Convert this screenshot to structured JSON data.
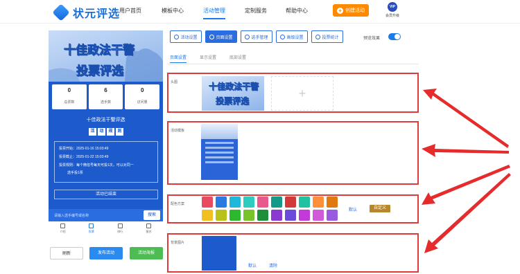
{
  "brand": {
    "name": "状元评选"
  },
  "nav": {
    "home": "用户首页",
    "templates": "模板中心",
    "activity": "活动管理",
    "custom": "定制服务",
    "help": "帮助中心"
  },
  "header": {
    "create_label": "创建活动",
    "vip_badge": "VIP",
    "vip_label": "会员升级"
  },
  "phone": {
    "banner_line1": "十佳政法干警",
    "banner_line2": "投票评选",
    "stats": [
      {
        "value": "0",
        "label": "总票数"
      },
      {
        "value": "6",
        "label": "选手数"
      },
      {
        "value": "0",
        "label": "访问量"
      }
    ],
    "title": "十佳政法干警评选",
    "rules_chars": [
      "活",
      "动",
      "规",
      "则"
    ],
    "rules": [
      "投票开始：2025-01-16 15:03:49",
      "投票截止：2025-01-22 15:03:49",
      "投票规则：每个微信号每天可投1次，可以对同一",
      "选手投1票"
    ],
    "status": "活动已结束",
    "search_placeholder": "请输入选手编号或名称",
    "search_button": "搜索",
    "tabs": [
      "介绍",
      "投票",
      "排行",
      "报名"
    ]
  },
  "bottom_buttons": {
    "refresh": "刷新",
    "publish": "发布活动",
    "poster": "活动海报"
  },
  "toolbar": {
    "items": [
      "活动设置",
      "页面设置",
      "选手管理",
      "高级设置",
      "投票统计"
    ],
    "preview_label": "预览效果"
  },
  "subtabs": [
    "页面设置",
    "显示设置",
    "底部设置"
  ],
  "panels": {
    "head_label": "头图",
    "head_img_line1": "十佳政法干警",
    "head_img_line2": "投票评选",
    "add_symbol": "+",
    "template_label": "活动模板",
    "color_label": "配色方案",
    "default_link": "默认",
    "custom_button": "自定义",
    "bg_label": "背景图片",
    "bg_default": "默认",
    "bg_clear": "清除"
  },
  "colors": {
    "accent": "#1b7be8",
    "swatches_row1": [
      "#e84a5f",
      "#2a7be0",
      "#1fb8d8",
      "#2ecbc0",
      "#e85a8c",
      "#159a8a",
      "#d23a3a",
      "#20c2a0",
      "#ff8f3a",
      "#e07a10"
    ],
    "swatches_row2": [
      "#f0c020",
      "#b8c21a",
      "#2db82d",
      "#7ac22a",
      "#1e8f3a",
      "#8a3ad0",
      "#6a4cd8",
      "#c23ad8",
      "#d05ad8",
      "#9a5ae0"
    ]
  }
}
